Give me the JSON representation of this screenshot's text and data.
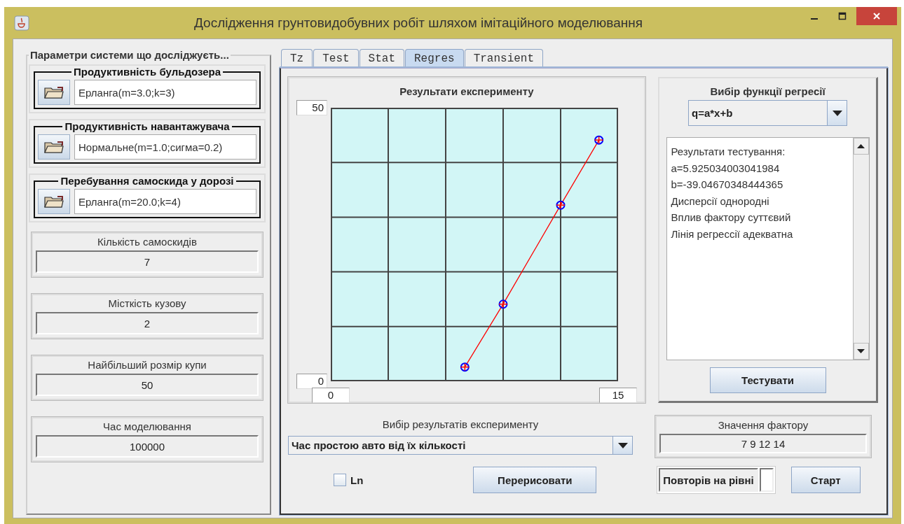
{
  "window": {
    "title": "Дослідження грунтовидобувних робіт шляхом імітаційного моделювання"
  },
  "parameters": {
    "title": "Параметри системи що досліджуєть...",
    "distributions": [
      {
        "label": "Продуктивність бульдозера",
        "value": "Ерланга(m=3.0;k=3)"
      },
      {
        "label": "Продуктивність навантажувача",
        "value": "Нормальне(m=1.0;сигма=0.2)"
      },
      {
        "label": "Перебування самоскида у дорозі",
        "value": "Ерланга(m=20.0;k=4)"
      }
    ],
    "fields": [
      {
        "label": "Кількість самоскидів",
        "value": "7"
      },
      {
        "label": "Місткість кузову",
        "value": "2"
      },
      {
        "label": "Найбільший розмір купи",
        "value": "50"
      },
      {
        "label": "Час моделювання",
        "value": "100000"
      }
    ]
  },
  "tabs": [
    {
      "label": "Tz",
      "selected": false
    },
    {
      "label": "Test",
      "selected": false
    },
    {
      "label": "Stat",
      "selected": false
    },
    {
      "label": "Regres",
      "selected": true
    },
    {
      "label": "Transient",
      "selected": false
    }
  ],
  "results_chart": {
    "title": "Результати експерименту",
    "chart_data": {
      "type": "line",
      "x": [
        7,
        9,
        12,
        14
      ],
      "series": [
        {
          "color": "#ff0000",
          "marker": "circle",
          "values": [
            2.6,
            14.1,
            32.2,
            44.1
          ]
        }
      ],
      "xlim": [
        0,
        15
      ],
      "ylim": [
        0,
        50
      ],
      "xticks": [
        0,
        15
      ],
      "yticks": [
        0,
        50
      ]
    }
  },
  "regression": {
    "title": "Вибір функції регресії",
    "function": "q=a*x+b",
    "results": [
      "Результати тестування:",
      "a=5.925034003041984",
      "b=-39.04670348444365",
      "Дисперсії однородні",
      "Вплив фактору суттєвий",
      "Лінія регрессії адекватна"
    ],
    "test_button": "Тестувати"
  },
  "experiment_select": {
    "label": "Вибір результатів експерименту",
    "value": "Час простою авто від їх кількості"
  },
  "factor": {
    "label": "Значення фактору",
    "value": "7 9  12 14"
  },
  "ln_checkbox": {
    "label": "Ln",
    "checked": false
  },
  "redraw_button": "Перерисовати",
  "repeats": {
    "label": "Повторів на рівні"
  },
  "start_button": "Старт"
}
